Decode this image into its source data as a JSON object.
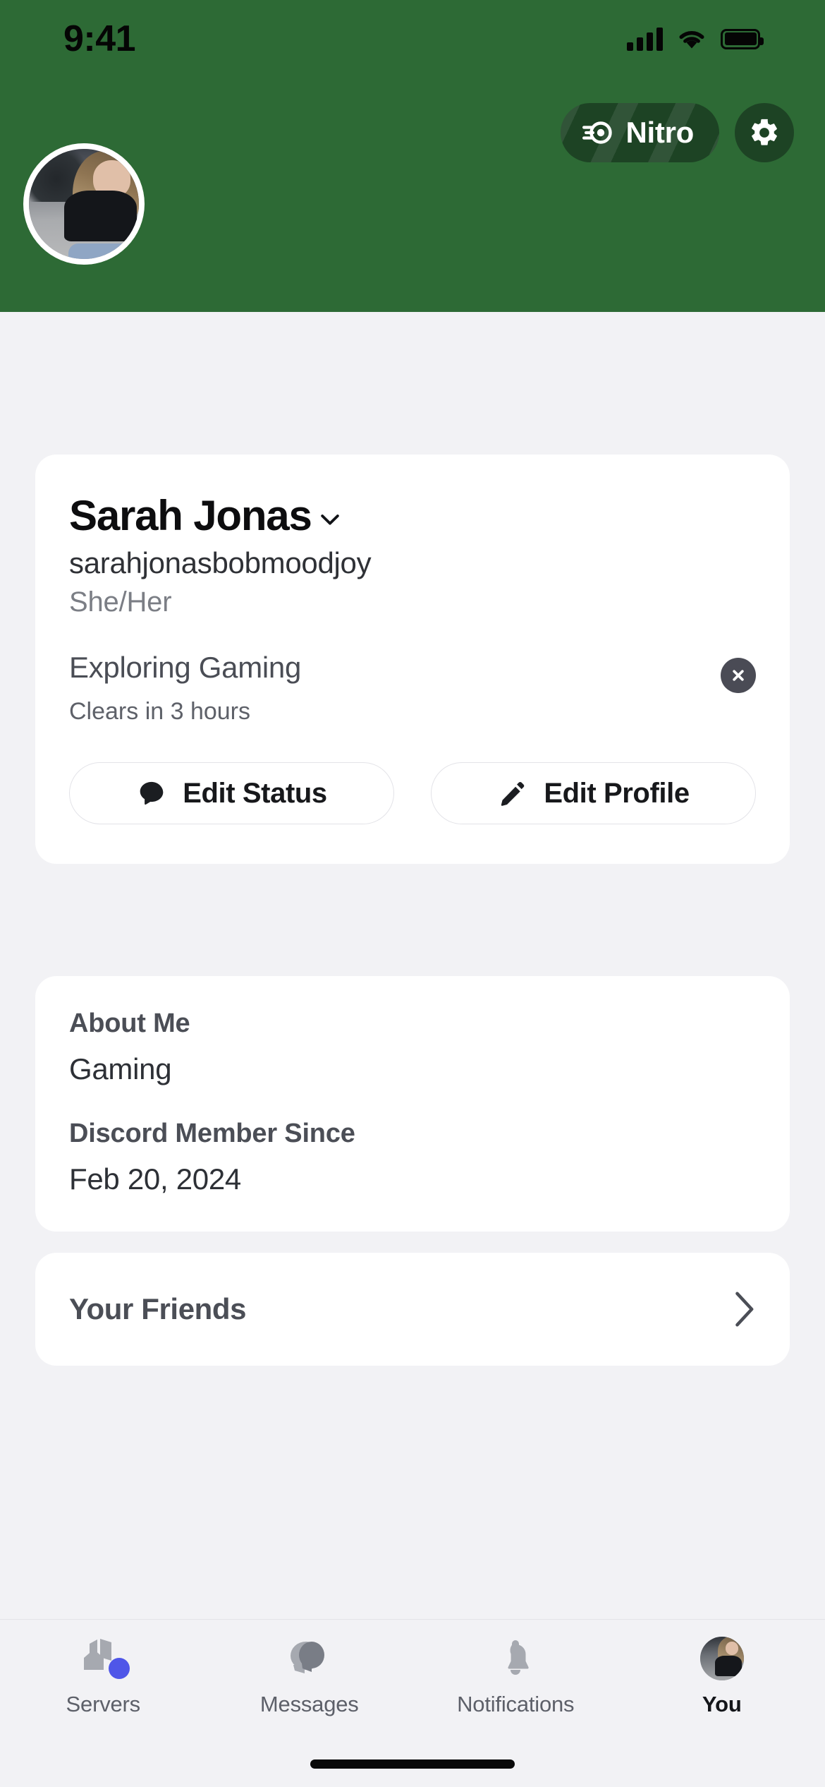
{
  "status_bar": {
    "time": "9:41",
    "icons": [
      "cellular-signal-icon",
      "wifi-icon",
      "battery-icon"
    ],
    "battery_level": 100
  },
  "header": {
    "banner_color": "#2d6a35",
    "nitro_button": {
      "label": "Nitro",
      "icon": "nitro-wheel-icon",
      "background": "#1d4324"
    },
    "settings_button": {
      "icon": "gear-icon",
      "background": "#1d4324"
    }
  },
  "profile": {
    "avatar": "user-avatar",
    "display_name": "Sarah Jonas",
    "name_chevron_icon": "chevron-down-icon",
    "username": "sarahjonasbobmoodjoy",
    "pronouns": "She/Her",
    "custom_status": {
      "text": "Exploring Gaming",
      "expiry": "Clears in 3 hours",
      "clear_icon": "close-circle-icon"
    },
    "actions": [
      {
        "label": "Edit Status",
        "icon": "speech-bubble-icon"
      },
      {
        "label": "Edit Profile",
        "icon": "pencil-icon"
      }
    ]
  },
  "about": {
    "about_me_heading": "About Me",
    "about_me_value": "Gaming",
    "member_since_heading": "Discord Member Since",
    "member_since_value": "Feb 20, 2024"
  },
  "friends": {
    "label": "Your Friends",
    "chevron_icon": "chevron-right-icon"
  },
  "tab_bar": {
    "items": [
      {
        "label": "Servers",
        "icon": "servers-icon",
        "active": false,
        "badge": true
      },
      {
        "label": "Messages",
        "icon": "messages-icon",
        "active": false,
        "badge": false
      },
      {
        "label": "Notifications",
        "icon": "bell-icon",
        "active": false,
        "badge": false
      },
      {
        "label": "You",
        "icon": "user-avatar-icon",
        "active": true,
        "badge": false
      }
    ],
    "badge_color": "#4f56e8"
  },
  "colors": {
    "banner_green": "#2d6a35",
    "page_background": "#f2f2f5",
    "card_white": "#ffffff",
    "accent_blue": "#4f56e8"
  }
}
